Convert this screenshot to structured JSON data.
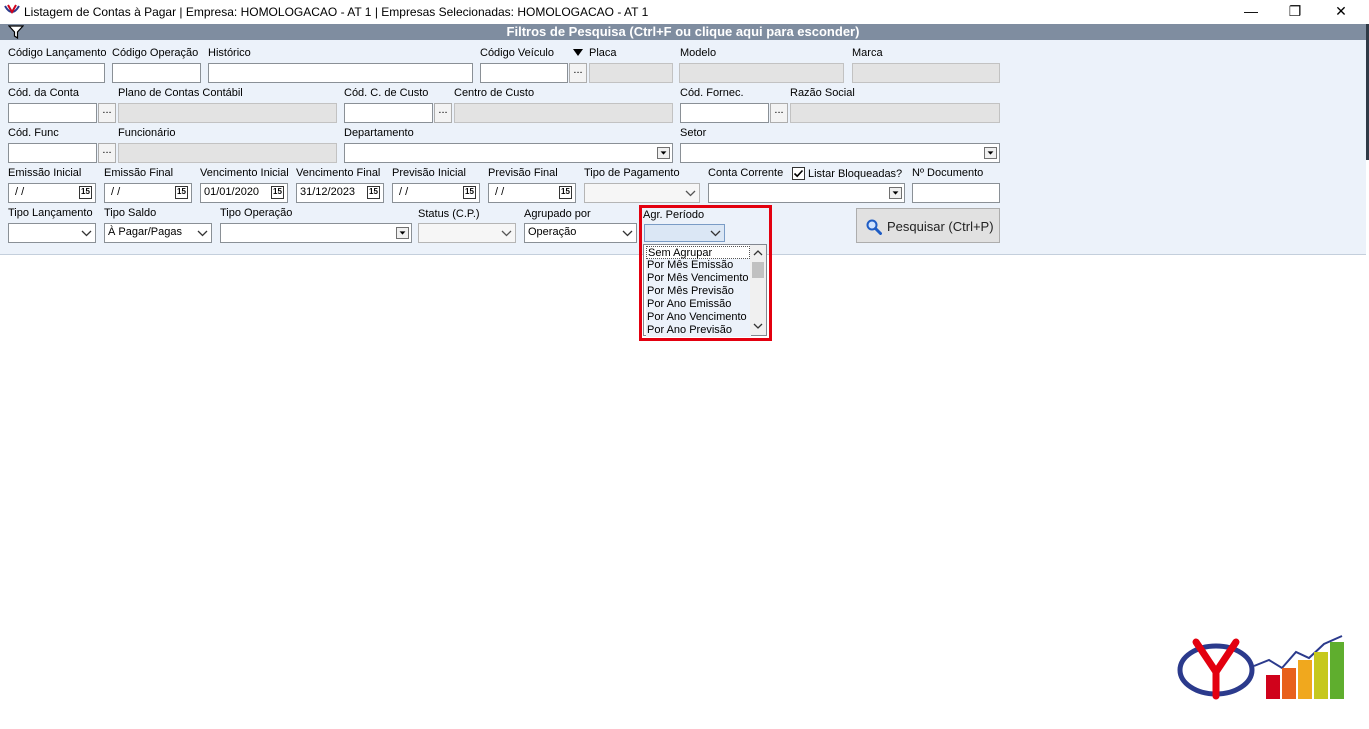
{
  "window": {
    "title": "Listagem de Contas à Pagar | Empresa: HOMOLOGACAO - AT 1 | Empresas Selecionadas: HOMOLOGACAO - AT 1",
    "minimize_glyph": "—",
    "restore_glyph": "❐",
    "close_glyph": "✕"
  },
  "filter": {
    "header_title": "Filtros de Pesquisa (Ctrl+F ou clique aqui para esconder)",
    "labels": {
      "codigo_lancamento": "Código Lançamento",
      "codigo_operacao": "Código Operação",
      "historico": "Histórico",
      "codigo_veiculo": "Código Veículo",
      "placa": "Placa",
      "modelo": "Modelo",
      "marca": "Marca",
      "cod_conta": "Cód. da Conta",
      "plano_contas": "Plano de Contas Contábil",
      "cod_centro_custo": "Cód. C. de Custo",
      "centro_custo": "Centro de Custo",
      "cod_fornec": "Cód. Fornec.",
      "razao_social": "Razão Social",
      "cod_func": "Cód. Func",
      "funcionario": "Funcionário",
      "departamento": "Departamento",
      "setor": "Setor",
      "emissao_inicial": "Emissão Inicial",
      "emissao_final": "Emissão Final",
      "vencimento_inicial": "Vencimento Inicial",
      "vencimento_final": "Vencimento Final",
      "previsao_inicial": "Previsão Inicial",
      "previsao_final": "Previsão Final",
      "tipo_pagamento": "Tipo de Pagamento",
      "conta_corrente": "Conta Corrente",
      "listar_bloqueadas": "Listar Bloqueadas?",
      "n_documento": "Nº Documento",
      "tipo_lancamento": "Tipo Lançamento",
      "tipo_saldo": "Tipo Saldo",
      "tipo_operacao": "Tipo Operação",
      "status_cp": "Status (C.P.)",
      "agrupado_por": "Agrupado por",
      "agr_periodo": "Agr. Período"
    },
    "values": {
      "emissao_inicial": " / /",
      "emissao_final": " / /",
      "vencimento_inicial": "01/01/2020",
      "vencimento_final": "31/12/2023",
      "previsao_inicial": " / /",
      "previsao_final": " / /",
      "tipo_saldo": "À Pagar/Pagas",
      "agrupado_por": "Operação",
      "listar_bloqueadas_checked": true
    },
    "ellipsis": "...",
    "calendar_glyph": "15",
    "search_button": "Pesquisar (Ctrl+P)",
    "agr_periodo_options": [
      "Sem Agrupar",
      "Por Mês Emissão",
      "Por Mês Vencimento",
      "Por Mês Previsão",
      "Por Ano Emissão",
      "Por Ano Vencimento",
      "Por Ano Previsão"
    ]
  },
  "colors": {
    "header_bg": "#7f8da0",
    "panel_bg": "#ecf2fa",
    "highlight": "#e3000f"
  }
}
